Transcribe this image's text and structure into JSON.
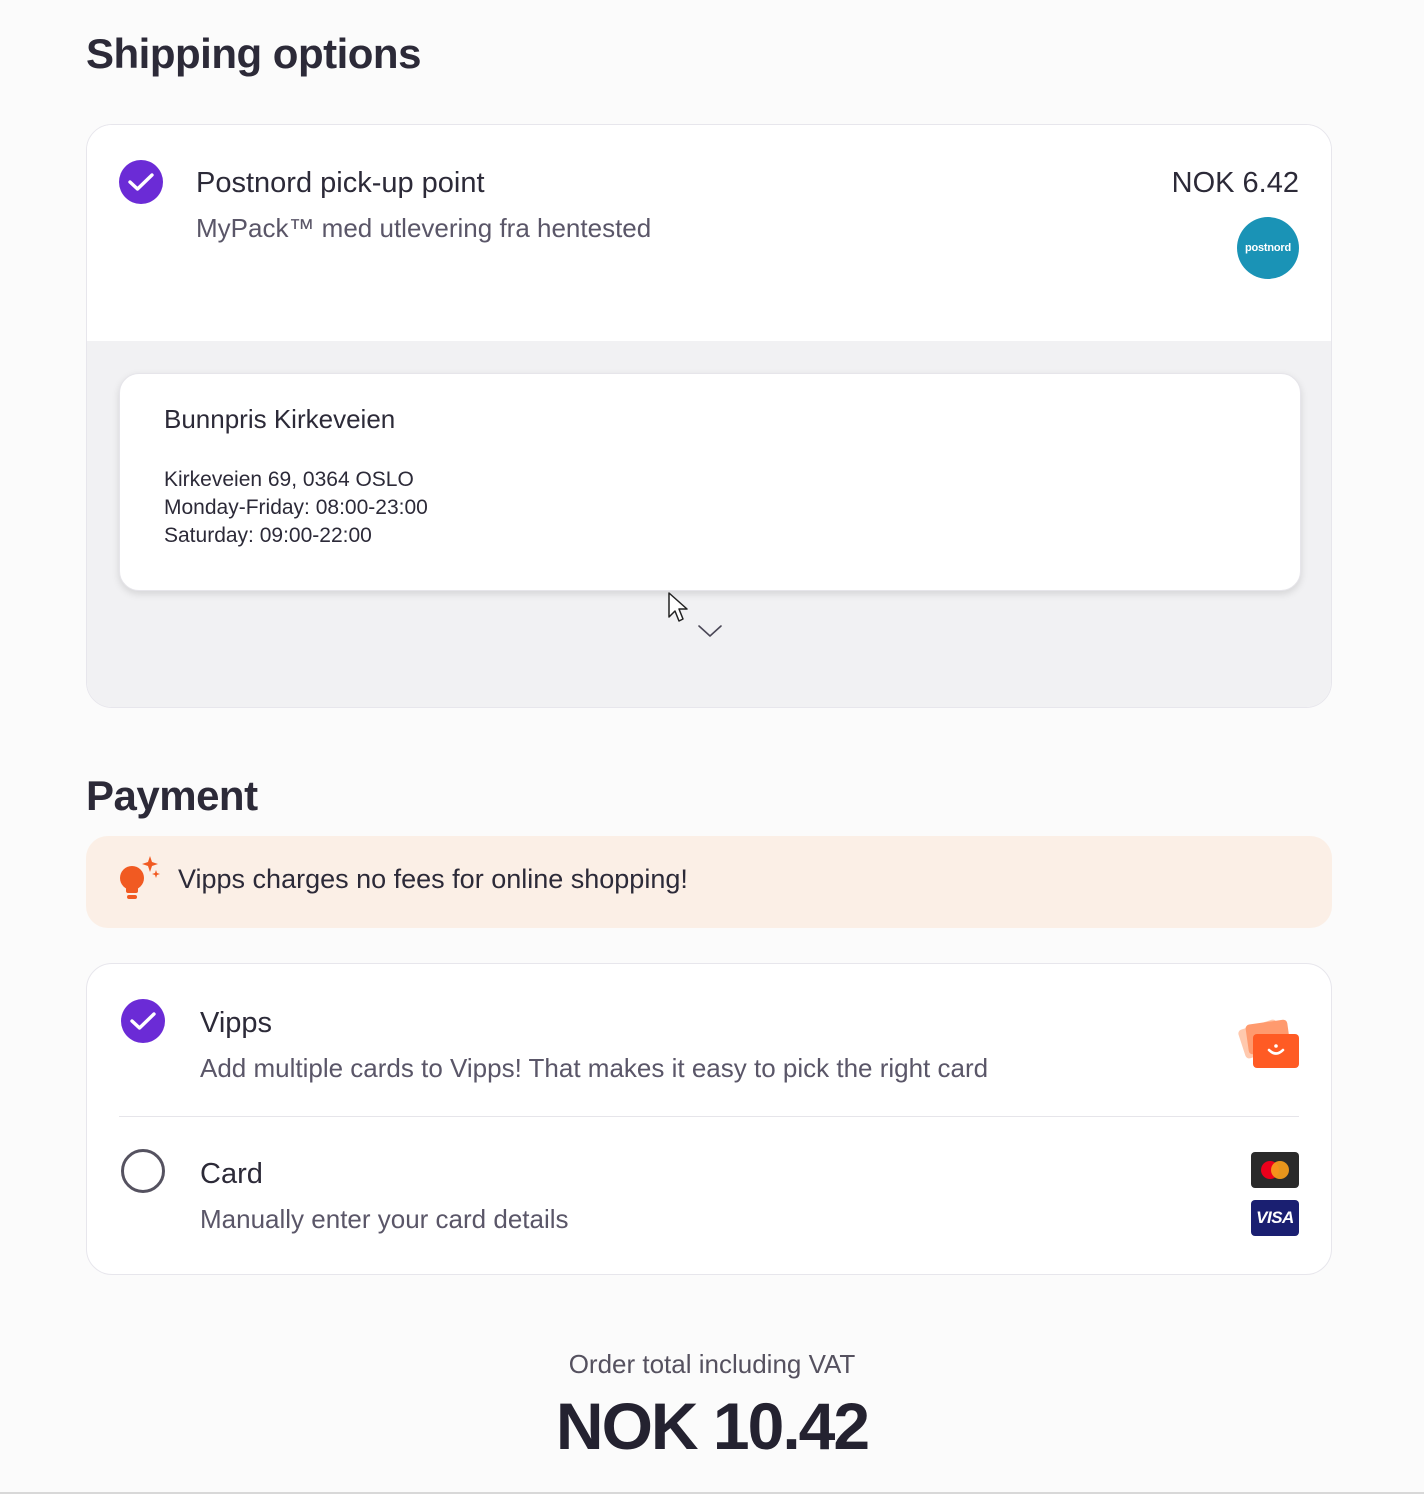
{
  "shipping": {
    "heading": "Shipping options",
    "option": {
      "title": "Postnord pick-up point",
      "subtitle": "MyPack™ med utlevering fra hentested",
      "price": "NOK 6.42",
      "logo_text": "postnord",
      "selected": true
    },
    "pickup": {
      "name": "Bunnpris Kirkeveien",
      "address": "Kirkeveien 69, 0364 OSLO",
      "hours_weekdays": "Monday-Friday: 08:00-23:00",
      "hours_saturday": "Saturday: 09:00-22:00"
    }
  },
  "payment": {
    "heading": "Payment",
    "tip": "Vipps charges no fees for online shopping!",
    "options": [
      {
        "title": "Vipps",
        "subtitle": "Add multiple cards to Vipps! That makes it easy to pick the right card",
        "selected": true
      },
      {
        "title": "Card",
        "subtitle": "Manually enter your card details",
        "selected": false
      }
    ],
    "card_brands": {
      "visa": "VISA"
    }
  },
  "total": {
    "label": "Order total including VAT",
    "amount": "NOK 10.42"
  },
  "colors": {
    "accent": "#6b2bd6",
    "vipps": "#ff5b24",
    "postnord": "#1a93b6"
  }
}
